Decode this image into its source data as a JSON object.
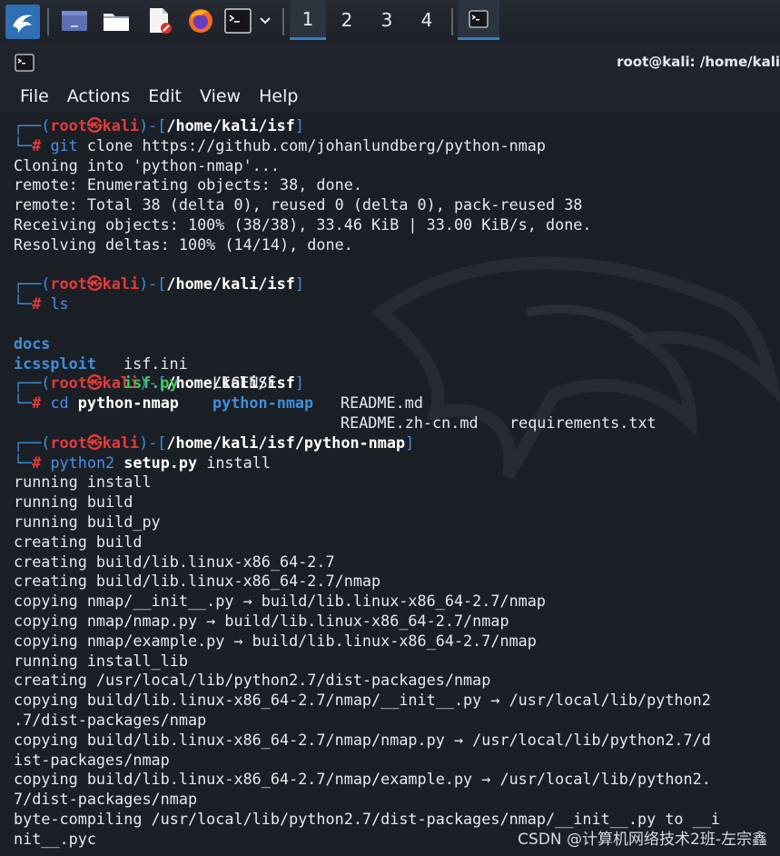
{
  "taskbar": {
    "workspaces": [
      "1",
      "2",
      "3",
      "4"
    ],
    "active_workspace": "1"
  },
  "window": {
    "title": "root@kali: /home/kali"
  },
  "menu": [
    "File",
    "Actions",
    "Edit",
    "View",
    "Help"
  ],
  "prompt": {
    "user": "root",
    "sep": "㉿",
    "host": "kali"
  },
  "blocks": {
    "b1": {
      "dir": "/home/kali/isf",
      "cmd": "git",
      "args": " clone https://github.com/johanlundberg/python-nmap",
      "output": [
        "Cloning into 'python-nmap'...",
        "remote: Enumerating objects: 38, done.",
        "remote: Total 38 (delta 0), reused 0 (delta 0), pack-reused 38",
        "Receiving objects: 100% (38/38), 33.46 KiB | 33.00 KiB/s, done.",
        "Resolving deltas: 100% (14/14), done."
      ]
    },
    "b2": {
      "dir": "/home/kali/isf",
      "cmd": "ls",
      "ls": {
        "r1": [
          "docs",
          "isf.ini",
          "LICENSE",
          "README.md",
          "requirements.txt"
        ],
        "r2": [
          "icssploit",
          "isf.py",
          "python-nmap",
          "README.zh-cn.md"
        ]
      }
    },
    "b3": {
      "dir": "/home/kali/isf",
      "cmd": "cd",
      "arg": "python-nmap"
    },
    "b4": {
      "dir": "/home/kali/isf/python-nmap",
      "cmd": "python2",
      "arg_bold": "setup.py",
      "arg": " install",
      "output": [
        "running install",
        "running build",
        "running build_py",
        "creating build",
        "creating build/lib.linux-x86_64-2.7",
        "creating build/lib.linux-x86_64-2.7/nmap",
        "copying nmap/__init__.py → build/lib.linux-x86_64-2.7/nmap",
        "copying nmap/nmap.py → build/lib.linux-x86_64-2.7/nmap",
        "copying nmap/example.py → build/lib.linux-x86_64-2.7/nmap",
        "running install_lib",
        "creating /usr/local/lib/python2.7/dist-packages/nmap",
        "copying build/lib.linux-x86_64-2.7/nmap/__init__.py → /usr/local/lib/python2",
        ".7/dist-packages/nmap",
        "copying build/lib.linux-x86_64-2.7/nmap/nmap.py → /usr/local/lib/python2.7/d",
        "ist-packages/nmap",
        "copying build/lib.linux-x86_64-2.7/nmap/example.py → /usr/local/lib/python2.",
        "7/dist-packages/nmap",
        "byte-compiling /usr/local/lib/python2.7/dist-packages/nmap/__init__.py to __i",
        "nit__.pyc"
      ]
    }
  },
  "watermark": "CSDN @计算机网络技术2班-左宗鑫",
  "colors": {
    "prompt_blue": "#3f8fd9",
    "prompt_red": "#e63b3b",
    "exec_green": "#3ec75f",
    "accent": "#3b7ec4"
  }
}
